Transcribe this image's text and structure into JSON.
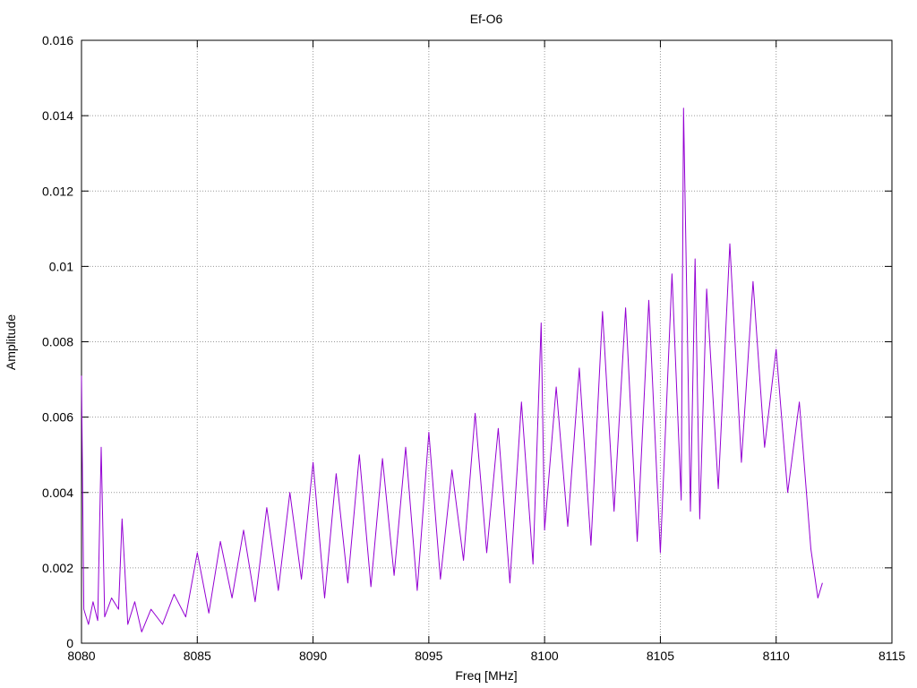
{
  "chart_data": {
    "type": "line",
    "title": "Ef-O6",
    "xlabel": "Freq [MHz]",
    "ylabel": "Amplitude",
    "xlim": [
      8080,
      8115
    ],
    "ylim": [
      0,
      0.016
    ],
    "xticks": [
      "8080",
      "8085",
      "8090",
      "8095",
      "8100",
      "8105",
      "8110",
      "8115"
    ],
    "yticks": [
      "0",
      "0.002",
      "0.004",
      "0.006",
      "0.008",
      "0.01",
      "0.012",
      "0.014",
      "0.016"
    ],
    "grid": true,
    "series": [
      {
        "color": "#9400d3",
        "x": [
          8080.0,
          8080.1,
          8080.3,
          8080.5,
          8080.7,
          8080.85,
          8081.0,
          8081.3,
          8081.6,
          8081.75,
          8082.0,
          8082.3,
          8082.6,
          8083.0,
          8083.5,
          8084.0,
          8084.5,
          8085.0,
          8085.5,
          8086.0,
          8086.5,
          8087.0,
          8087.5,
          8088.0,
          8088.5,
          8089.0,
          8089.5,
          8090.0,
          8090.5,
          8091.0,
          8091.5,
          8092.0,
          8092.5,
          8093.0,
          8093.5,
          8094.0,
          8094.5,
          8095.0,
          8095.5,
          8096.0,
          8096.5,
          8097.0,
          8097.5,
          8098.0,
          8098.5,
          8099.0,
          8099.5,
          8099.85,
          8100.0,
          8100.5,
          8101.0,
          8101.5,
          8102.0,
          8102.5,
          8103.0,
          8103.5,
          8104.0,
          8104.5,
          8105.0,
          8105.5,
          8105.9,
          8106.0,
          8106.3,
          8106.5,
          8106.7,
          8107.0,
          8107.5,
          8108.0,
          8108.5,
          8109.0,
          8109.5,
          8110.0,
          8110.5,
          8111.0,
          8111.5,
          8111.8,
          8112.0
        ],
        "values": [
          0.0071,
          0.0009,
          0.0005,
          0.0011,
          0.0006,
          0.0052,
          0.0007,
          0.0012,
          0.0009,
          0.0033,
          0.0005,
          0.0011,
          0.0003,
          0.0009,
          0.0005,
          0.0013,
          0.0007,
          0.0024,
          0.0008,
          0.0027,
          0.0012,
          0.003,
          0.0011,
          0.0036,
          0.0014,
          0.004,
          0.0017,
          0.0048,
          0.0012,
          0.0045,
          0.0016,
          0.005,
          0.0015,
          0.0049,
          0.0018,
          0.0052,
          0.0014,
          0.0056,
          0.0017,
          0.0046,
          0.0022,
          0.0061,
          0.0024,
          0.0057,
          0.0016,
          0.0064,
          0.0021,
          0.0085,
          0.003,
          0.0068,
          0.0031,
          0.0073,
          0.0026,
          0.0088,
          0.0035,
          0.0089,
          0.0027,
          0.0091,
          0.0024,
          0.0098,
          0.0038,
          0.0142,
          0.0035,
          0.0102,
          0.0033,
          0.0094,
          0.0041,
          0.0106,
          0.0048,
          0.0096,
          0.0052,
          0.0078,
          0.004,
          0.0064,
          0.0025,
          0.0012,
          0.0016
        ]
      }
    ]
  }
}
